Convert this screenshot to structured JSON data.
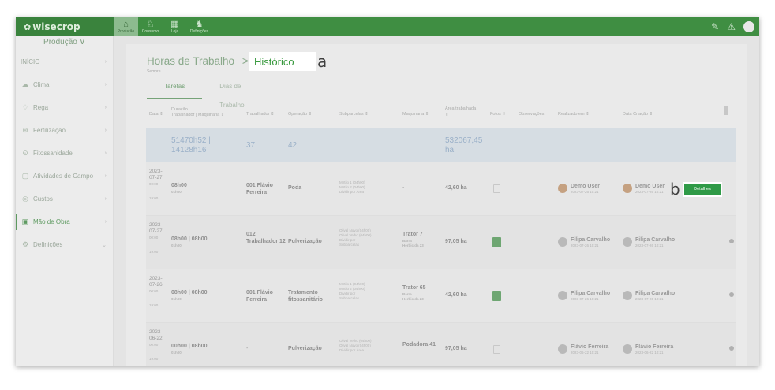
{
  "brand": {
    "logo": "wisecrop"
  },
  "modules": [
    {
      "label": "Produção",
      "icon": "tractor-icon",
      "glyph": "⌂",
      "active": true
    },
    {
      "label": "Consumo",
      "icon": "cart-icon",
      "glyph": "♘",
      "active": false
    },
    {
      "label": "Loja",
      "icon": "store-icon",
      "glyph": "▦",
      "active": false
    },
    {
      "label": "Definições",
      "icon": "people-icon",
      "glyph": "♞",
      "active": false
    }
  ],
  "topbar_right": {
    "edit_icon": "✎",
    "alert_icon": "⚠"
  },
  "sidebar": {
    "title": "Produção ∨",
    "items": [
      {
        "label": "INÍCIO",
        "icon": "home-icon",
        "glyph": "",
        "chev": "›"
      },
      {
        "label": "Clima",
        "icon": "cloud-icon",
        "glyph": "☁",
        "chev": "›"
      },
      {
        "label": "Rega",
        "icon": "drop-icon",
        "glyph": "♢",
        "chev": "›"
      },
      {
        "label": "Fertilização",
        "icon": "fertilizer-icon",
        "glyph": "⊛",
        "chev": "›"
      },
      {
        "label": "Fitossanidade",
        "icon": "shield-icon",
        "glyph": "⊙",
        "chev": "›"
      },
      {
        "label": "Atividades de Campo",
        "icon": "field-icon",
        "glyph": "▢",
        "chev": "›"
      },
      {
        "label": "Custos",
        "icon": "coins-icon",
        "glyph": "◎",
        "chev": "›"
      },
      {
        "label": "Mão de Obra",
        "icon": "worker-icon",
        "glyph": "▣",
        "chev": "›",
        "active": true
      },
      {
        "label": "Definições",
        "icon": "gear-icon",
        "glyph": "⚙",
        "chev": "⌄"
      }
    ]
  },
  "header": {
    "title": "Horas de Trabalho",
    "separator": ">",
    "active_crumb": "Histórico",
    "annotation_a": "a",
    "subtitle": "Sempre"
  },
  "tabs": [
    {
      "label": "Tarefas",
      "active": true
    },
    {
      "label": "Dias de Trabalho",
      "active": false
    }
  ],
  "columns": {
    "data": "Data ⇕",
    "duracao": "Duração",
    "duracao_sub": "Trabalhador | Maquinaria ⇕",
    "trabalhador": "Trabalhador ⇕",
    "operacao": "Operação ⇕",
    "subparcelas": "Subparcelas ⇕",
    "maquinaria": "Maquinaria ⇕",
    "area": "Área trabalhada",
    "area_sort": "⇕",
    "fotos": "Fotos ⇕",
    "observacoes": "Observações",
    "realizado": "Realizado em ⇕",
    "criacao": "Data Criação ⇕"
  },
  "totals": {
    "duration_line1": "51470h52 |",
    "duration_line2": "14128h16",
    "workers": "37",
    "operations": "42",
    "area_line1": "532067,45",
    "area_line2": "ha"
  },
  "rows": [
    {
      "date_line1": "2023-",
      "date_line2": "07-27",
      "time_start": "00:00",
      "time_end": "19:00",
      "duration": "08h00",
      "duration_sub": "01h00",
      "worker": "001 Flávio Ferreira",
      "operation": "Poda",
      "subparcels": [
        "Mirtilo 1 (04h00)",
        "Mirtilo 2 (04h00)"
      ],
      "subparcels_note": "Dividir por Área",
      "machinery": "-",
      "machinery_sub": "",
      "machinery_sub2": "",
      "area": "42,60 ha",
      "obs": "empty",
      "done_by": "Demo User",
      "done_date": "2023-07-26 10:21",
      "created_by": "Demo User",
      "created_date": "2023-07-26 10:21",
      "action": "Detalhes",
      "annotation_b": "b"
    },
    {
      "date_line1": "2023-",
      "date_line2": "07-27",
      "time_start": "00:00",
      "time_end": "19:00",
      "duration": "08h00 | 08h00",
      "duration_sub": "01h00",
      "worker": "012 Trabalhador 12",
      "operation": "Pulverização",
      "subparcels": [
        "Olival Novo (04h00)",
        "Olival Velho (04h00)"
      ],
      "subparcels_note": "Dividir por Subparcelas",
      "machinery": "Trator 7",
      "machinery_sub": "Barra",
      "machinery_sub2": "Herbicida 23",
      "area": "97,05 ha",
      "obs": "filled",
      "done_by": "Filipa Carvalho",
      "done_date": "2023-07-26 10:21",
      "created_by": "Filipa Carvalho",
      "created_date": "2023-07-26 10:21",
      "action": "",
      "annotation_b": ""
    },
    {
      "date_line1": "2023-",
      "date_line2": "07-26",
      "time_start": "00:00",
      "time_end": "19:00",
      "duration": "08h00 | 08h00",
      "duration_sub": "01h00",
      "worker": "001 Flávio Ferreira",
      "operation": "Tratamento fitossanitário",
      "subparcels": [
        "Mirtilo 1 (04h00)",
        "Mirtilo 2 (04h00)"
      ],
      "subparcels_note": "Dividir por Subparcelas",
      "machinery": "Trator 65",
      "machinery_sub": "Barra",
      "machinery_sub2": "Herbicida 23",
      "area": "42,60 ha",
      "obs": "filled",
      "done_by": "Filipa Carvalho",
      "done_date": "2023-07-26 10:21",
      "created_by": "Filipa Carvalho",
      "created_date": "2023-07-26 10:21",
      "action": "",
      "annotation_b": ""
    },
    {
      "date_line1": "2023-",
      "date_line2": "06-22",
      "time_start": "00:00",
      "time_end": "19:00",
      "duration": "00h00 | 08h00",
      "duration_sub": "01h00",
      "worker": "-",
      "operation": "Pulverização",
      "subparcels": [
        "Olival Velho (04h00)",
        "Olival Novo (04h00)"
      ],
      "subparcels_note": "Dividir por Área",
      "machinery": "Podadora 41",
      "machinery_sub": "",
      "machinery_sub2": "",
      "area": "97,05 ha",
      "obs": "empty",
      "done_by": "Flávio Ferreira",
      "done_date": "2023-06-22 10:21",
      "created_by": "Flávio Ferreira",
      "created_date": "2023-06-22 10:21",
      "action": "",
      "annotation_b": ""
    }
  ]
}
